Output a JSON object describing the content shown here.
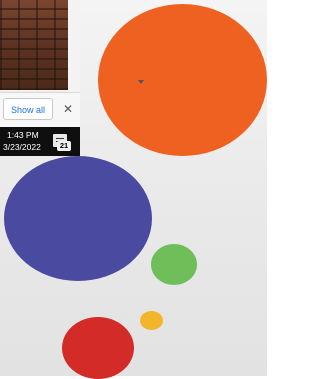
{
  "downloads_bar": {
    "show_all_label": "Show all",
    "close_icon": "close-icon",
    "chevron_icon": "chevron-down-icon"
  },
  "taskbar": {
    "time": "1:43 PM",
    "date": "3/23/2022",
    "notification_icon": "notification-icon",
    "notification_count": "21"
  },
  "colors": {
    "orange": "#ef6120",
    "blue": "#4b4aa1",
    "green": "#6fbe5a",
    "yellow": "#f2b52b",
    "red": "#d22b28",
    "link_blue": "#1a73e8"
  }
}
